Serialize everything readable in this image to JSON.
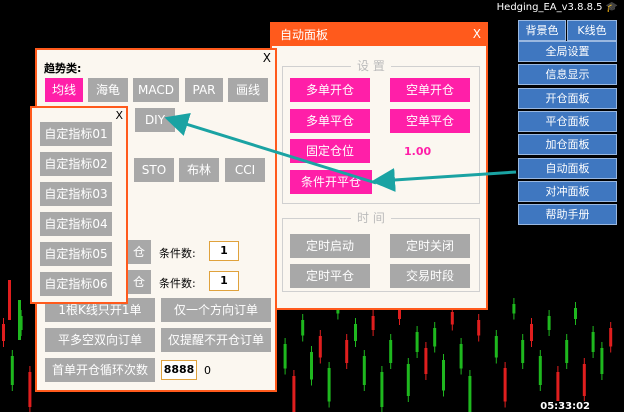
{
  "header": {
    "version": "Hedging_EA_v3.8.8.5"
  },
  "icons": {
    "cap": "graduation-cap-icon",
    "close": "close-icon"
  },
  "colors": {
    "pink": "#ff1fa8",
    "orange": "#ff5a1c",
    "blue": "#3f77c0",
    "gray": "#a8a8a8",
    "arrow": "#1aa3a3"
  },
  "sidebar": {
    "top": [
      "背景色",
      "K线色"
    ],
    "items": [
      "全局设置",
      "信息显示",
      "开仓面板",
      "平仓面板",
      "加仓面板",
      "自动面板",
      "对冲面板",
      "帮助手册"
    ]
  },
  "auto_panel": {
    "title": "自动面板",
    "close": "X",
    "settings_label": "设 置",
    "time_label": "时 间",
    "buttons": [
      "多单开仓",
      "空单开仓",
      "多单平仓",
      "空单平仓",
      "固定仓位",
      "条件开平仓"
    ],
    "fixed_value": "1.00",
    "time_buttons": [
      "定时启动",
      "定时关闭",
      "定时平仓",
      "交易时段"
    ]
  },
  "trend_panel": {
    "close": "X",
    "title": "趋势类:",
    "row1": [
      "均线",
      "海龟",
      "MACD",
      "PAR",
      "画线"
    ],
    "diy": "DIY",
    "row2_visible": [
      "STO",
      "布林",
      "CCI"
    ],
    "cond_label": "条件数:",
    "cond_values": [
      "1",
      "1"
    ],
    "partial1": "仓",
    "partial2": "仓",
    "option_buttons": [
      "1根K线只开1单",
      "仅一个方向订单",
      "平多空双向订单",
      "仅提醒不开仓订单"
    ],
    "loop_label": "首单开仓循环次数",
    "loop_value": "8888",
    "loop_suffix": "0"
  },
  "custom_panel": {
    "close": "X",
    "items": [
      "自定指标01",
      "自定指标02",
      "自定指标03",
      "自定指标04",
      "自定指标05",
      "自定指标06"
    ]
  },
  "footer": {
    "time": "05:33:02"
  }
}
